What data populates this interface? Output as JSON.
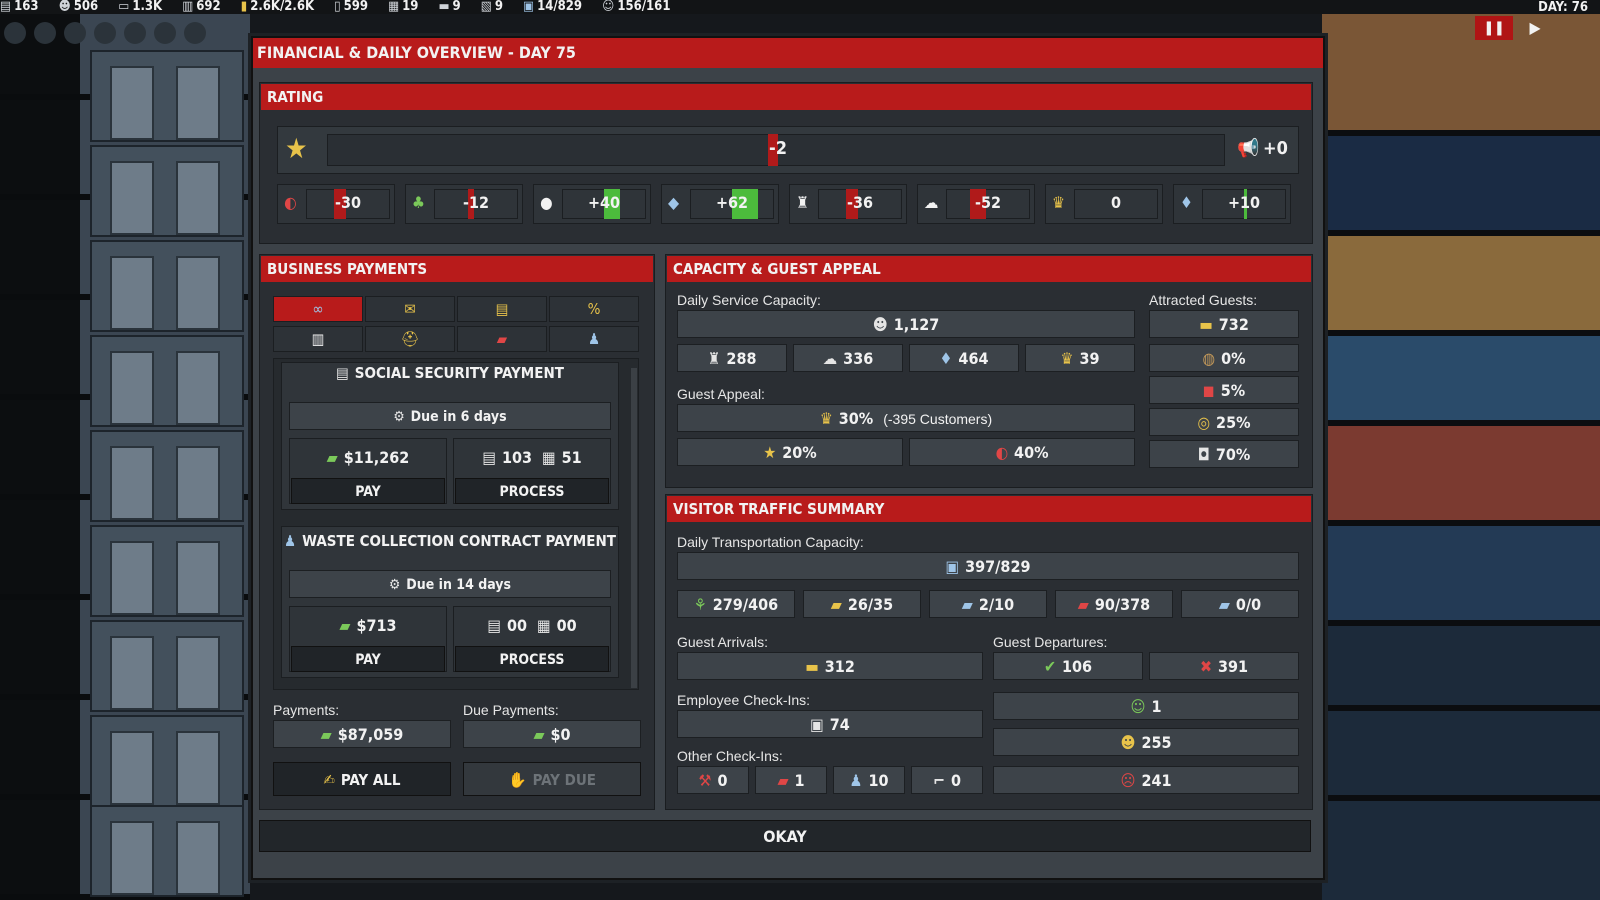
{
  "hud": {
    "stats": [
      "163",
      "506",
      "1.3K",
      "692",
      "2.6K/2.6K",
      "599",
      "19",
      "9",
      "9",
      "14/829",
      "156/161"
    ],
    "day": "DAY: 76"
  },
  "modal": {
    "title": "FINANCIAL & DAILY OVERVIEW - DAY 75",
    "okay": "OKAY"
  },
  "rating": {
    "title": "RATING",
    "main_value": "-2",
    "promo_value": "+0",
    "subs": [
      "-30",
      "-12",
      "+40",
      "+62",
      "-36",
      "-52",
      "0",
      "+10"
    ]
  },
  "business": {
    "title": "BUSINESS PAYMENTS",
    "card1": {
      "title": "SOCIAL SECURITY PAYMENT",
      "due": "Due in 6 days",
      "amount": "$11,262",
      "docs_a": "103",
      "docs_b": "51",
      "pay": "PAY",
      "process": "PROCESS"
    },
    "card2": {
      "title": "WASTE COLLECTION CONTRACT PAYMENT",
      "due": "Due in 14 days",
      "amount": "$713",
      "docs_a": "00",
      "docs_b": "00",
      "pay": "PAY",
      "process": "PROCESS"
    },
    "payments_label": "Payments:",
    "payments_value": "$87,059",
    "due_label": "Due Payments:",
    "due_value": "$0",
    "pay_all": "PAY ALL",
    "pay_due": "PAY DUE"
  },
  "capacity": {
    "title": "CAPACITY & GUEST APPEAL",
    "daily_label": "Daily Service Capacity:",
    "daily_value": "1,127",
    "subs": [
      "288",
      "336",
      "464",
      "39"
    ],
    "appeal_label": "Guest Appeal:",
    "appeal_value": "30%",
    "appeal_customers": "(-395 Customers)",
    "appeal_a": "20%",
    "appeal_b": "40%",
    "attracted_label": "Attracted Guests:",
    "attracted_value": "732",
    "attracted_list": [
      "0%",
      "5%",
      "25%",
      "70%"
    ]
  },
  "traffic": {
    "title": "VISITOR TRAFFIC SUMMARY",
    "transport_label": "Daily Transportation Capacity:",
    "transport_value": "397/829",
    "transport_subs": [
      "279/406",
      "26/35",
      "2/10",
      "90/378",
      "0/0"
    ],
    "arrivals_label": "Guest Arrivals:",
    "arrivals_value": "312",
    "departures_label": "Guest Departures:",
    "dep_ok": "106",
    "dep_bad": "391",
    "employee_label": "Employee Check-Ins:",
    "employee_value": "74",
    "other_label": "Other Check-Ins:",
    "other_values": [
      "0",
      "1",
      "10",
      "0"
    ],
    "mood": [
      "1",
      "255",
      "241"
    ]
  }
}
